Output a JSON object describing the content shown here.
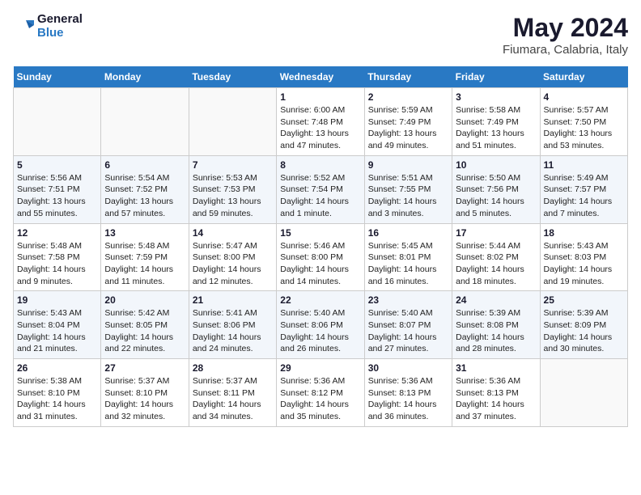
{
  "header": {
    "logo_line1": "General",
    "logo_line2": "Blue",
    "month": "May 2024",
    "location": "Fiumara, Calabria, Italy"
  },
  "weekdays": [
    "Sunday",
    "Monday",
    "Tuesday",
    "Wednesday",
    "Thursday",
    "Friday",
    "Saturday"
  ],
  "weeks": [
    {
      "days": [
        {
          "num": "",
          "info": ""
        },
        {
          "num": "",
          "info": ""
        },
        {
          "num": "",
          "info": ""
        },
        {
          "num": "1",
          "info": "Sunrise: 6:00 AM\nSunset: 7:48 PM\nDaylight: 13 hours\nand 47 minutes."
        },
        {
          "num": "2",
          "info": "Sunrise: 5:59 AM\nSunset: 7:49 PM\nDaylight: 13 hours\nand 49 minutes."
        },
        {
          "num": "3",
          "info": "Sunrise: 5:58 AM\nSunset: 7:49 PM\nDaylight: 13 hours\nand 51 minutes."
        },
        {
          "num": "4",
          "info": "Sunrise: 5:57 AM\nSunset: 7:50 PM\nDaylight: 13 hours\nand 53 minutes."
        }
      ]
    },
    {
      "days": [
        {
          "num": "5",
          "info": "Sunrise: 5:56 AM\nSunset: 7:51 PM\nDaylight: 13 hours\nand 55 minutes."
        },
        {
          "num": "6",
          "info": "Sunrise: 5:54 AM\nSunset: 7:52 PM\nDaylight: 13 hours\nand 57 minutes."
        },
        {
          "num": "7",
          "info": "Sunrise: 5:53 AM\nSunset: 7:53 PM\nDaylight: 13 hours\nand 59 minutes."
        },
        {
          "num": "8",
          "info": "Sunrise: 5:52 AM\nSunset: 7:54 PM\nDaylight: 14 hours\nand 1 minute."
        },
        {
          "num": "9",
          "info": "Sunrise: 5:51 AM\nSunset: 7:55 PM\nDaylight: 14 hours\nand 3 minutes."
        },
        {
          "num": "10",
          "info": "Sunrise: 5:50 AM\nSunset: 7:56 PM\nDaylight: 14 hours\nand 5 minutes."
        },
        {
          "num": "11",
          "info": "Sunrise: 5:49 AM\nSunset: 7:57 PM\nDaylight: 14 hours\nand 7 minutes."
        }
      ]
    },
    {
      "days": [
        {
          "num": "12",
          "info": "Sunrise: 5:48 AM\nSunset: 7:58 PM\nDaylight: 14 hours\nand 9 minutes."
        },
        {
          "num": "13",
          "info": "Sunrise: 5:48 AM\nSunset: 7:59 PM\nDaylight: 14 hours\nand 11 minutes."
        },
        {
          "num": "14",
          "info": "Sunrise: 5:47 AM\nSunset: 8:00 PM\nDaylight: 14 hours\nand 12 minutes."
        },
        {
          "num": "15",
          "info": "Sunrise: 5:46 AM\nSunset: 8:00 PM\nDaylight: 14 hours\nand 14 minutes."
        },
        {
          "num": "16",
          "info": "Sunrise: 5:45 AM\nSunset: 8:01 PM\nDaylight: 14 hours\nand 16 minutes."
        },
        {
          "num": "17",
          "info": "Sunrise: 5:44 AM\nSunset: 8:02 PM\nDaylight: 14 hours\nand 18 minutes."
        },
        {
          "num": "18",
          "info": "Sunrise: 5:43 AM\nSunset: 8:03 PM\nDaylight: 14 hours\nand 19 minutes."
        }
      ]
    },
    {
      "days": [
        {
          "num": "19",
          "info": "Sunrise: 5:43 AM\nSunset: 8:04 PM\nDaylight: 14 hours\nand 21 minutes."
        },
        {
          "num": "20",
          "info": "Sunrise: 5:42 AM\nSunset: 8:05 PM\nDaylight: 14 hours\nand 22 minutes."
        },
        {
          "num": "21",
          "info": "Sunrise: 5:41 AM\nSunset: 8:06 PM\nDaylight: 14 hours\nand 24 minutes."
        },
        {
          "num": "22",
          "info": "Sunrise: 5:40 AM\nSunset: 8:06 PM\nDaylight: 14 hours\nand 26 minutes."
        },
        {
          "num": "23",
          "info": "Sunrise: 5:40 AM\nSunset: 8:07 PM\nDaylight: 14 hours\nand 27 minutes."
        },
        {
          "num": "24",
          "info": "Sunrise: 5:39 AM\nSunset: 8:08 PM\nDaylight: 14 hours\nand 28 minutes."
        },
        {
          "num": "25",
          "info": "Sunrise: 5:39 AM\nSunset: 8:09 PM\nDaylight: 14 hours\nand 30 minutes."
        }
      ]
    },
    {
      "days": [
        {
          "num": "26",
          "info": "Sunrise: 5:38 AM\nSunset: 8:10 PM\nDaylight: 14 hours\nand 31 minutes."
        },
        {
          "num": "27",
          "info": "Sunrise: 5:37 AM\nSunset: 8:10 PM\nDaylight: 14 hours\nand 32 minutes."
        },
        {
          "num": "28",
          "info": "Sunrise: 5:37 AM\nSunset: 8:11 PM\nDaylight: 14 hours\nand 34 minutes."
        },
        {
          "num": "29",
          "info": "Sunrise: 5:36 AM\nSunset: 8:12 PM\nDaylight: 14 hours\nand 35 minutes."
        },
        {
          "num": "30",
          "info": "Sunrise: 5:36 AM\nSunset: 8:13 PM\nDaylight: 14 hours\nand 36 minutes."
        },
        {
          "num": "31",
          "info": "Sunrise: 5:36 AM\nSunset: 8:13 PM\nDaylight: 14 hours\nand 37 minutes."
        },
        {
          "num": "",
          "info": ""
        }
      ]
    }
  ]
}
